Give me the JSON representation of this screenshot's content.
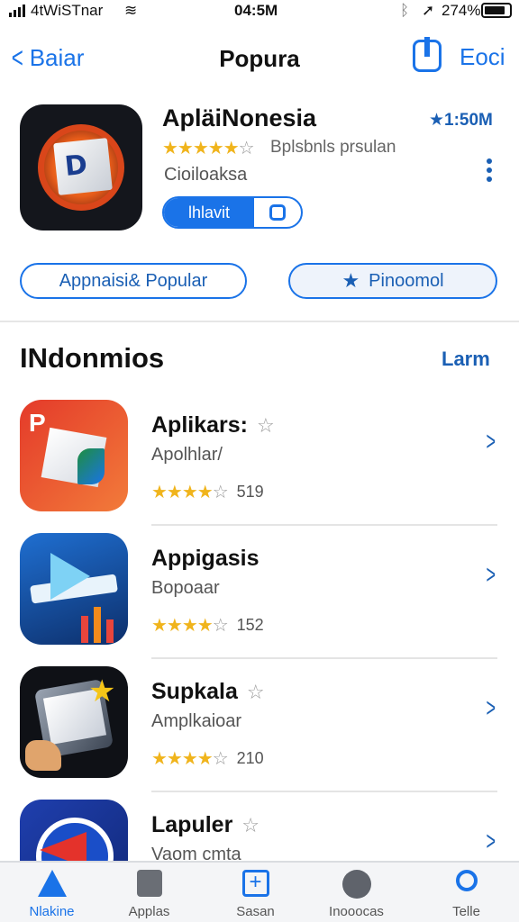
{
  "status_bar": {
    "carrier": "4tWiSTnar",
    "time": "04:5M",
    "battery": "274%"
  },
  "nav": {
    "back_label": "Baiar",
    "title": "Popura",
    "edit_label": "Eoci"
  },
  "featured": {
    "name": "ApläiNonesia",
    "size": "★1:50M",
    "stars": "★★★★★",
    "empty_star": "☆",
    "subtitle": "Bplsbnls prsulan",
    "developer": "Cioiloaksa",
    "install_label": "lhlavit"
  },
  "pills": {
    "left": "Appnaisi& Popular",
    "right": "Pinoomol",
    "right_icon": "star-icon"
  },
  "section": {
    "title": "INdonmios",
    "link": "Larm"
  },
  "apps": [
    {
      "name": "Aplikars:",
      "subtitle": "Apolhlar/",
      "stars": "★★★★",
      "empty": "☆",
      "count": "519"
    },
    {
      "name": "Appigasis",
      "subtitle": "Bopoaar",
      "stars": "★★★★",
      "empty": "☆",
      "count": "152"
    },
    {
      "name": "Supkala",
      "subtitle": "Amplkaioar",
      "stars": "★★★★",
      "empty": "☆",
      "count": "210"
    },
    {
      "name": "Lapuler",
      "subtitle": "Vaom cmta",
      "stars": "",
      "empty": "",
      "count": ""
    }
  ],
  "tabs": [
    {
      "label": "Nlakine",
      "icon": "featured-star-icon",
      "active": true
    },
    {
      "label": "Applas",
      "icon": "apps-bag-icon",
      "active": false
    },
    {
      "label": "Sasan",
      "icon": "add-icon",
      "active": false
    },
    {
      "label": "Inooocas",
      "icon": "updates-icon",
      "active": false
    },
    {
      "label": "Telle",
      "icon": "search-icon",
      "active": false
    }
  ],
  "colors": {
    "accent": "#1a73e8",
    "star": "#f0b41c"
  }
}
